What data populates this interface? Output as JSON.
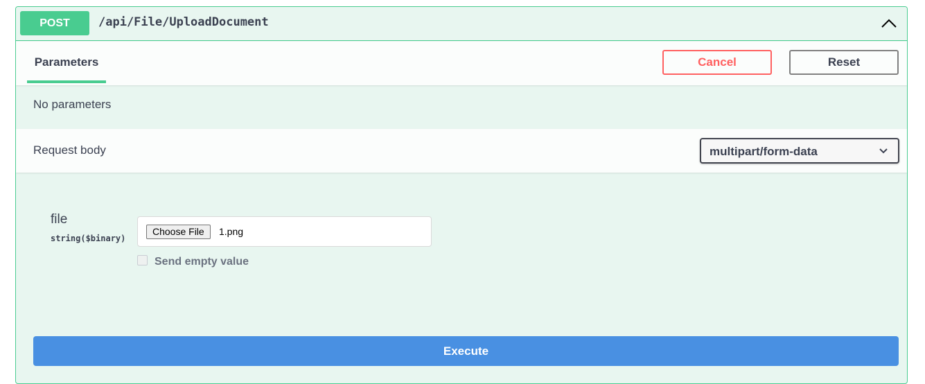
{
  "operation": {
    "method": "POST",
    "path": "/api/File/UploadDocument",
    "accent_color": "#49cc90",
    "collapse_icon": "chevron-up-icon"
  },
  "parameters": {
    "tab_label": "Parameters",
    "cancel_label": "Cancel",
    "reset_label": "Reset",
    "empty_text": "No parameters"
  },
  "request_body": {
    "label": "Request body",
    "content_type": "multipart/form-data",
    "fields": [
      {
        "name": "file",
        "type": "string($binary)",
        "choose_label": "Choose File",
        "selected_file": "1.png",
        "send_empty_label": "Send empty value",
        "send_empty_checked": false
      }
    ]
  },
  "execute": {
    "label": "Execute",
    "color": "#4990e2"
  }
}
